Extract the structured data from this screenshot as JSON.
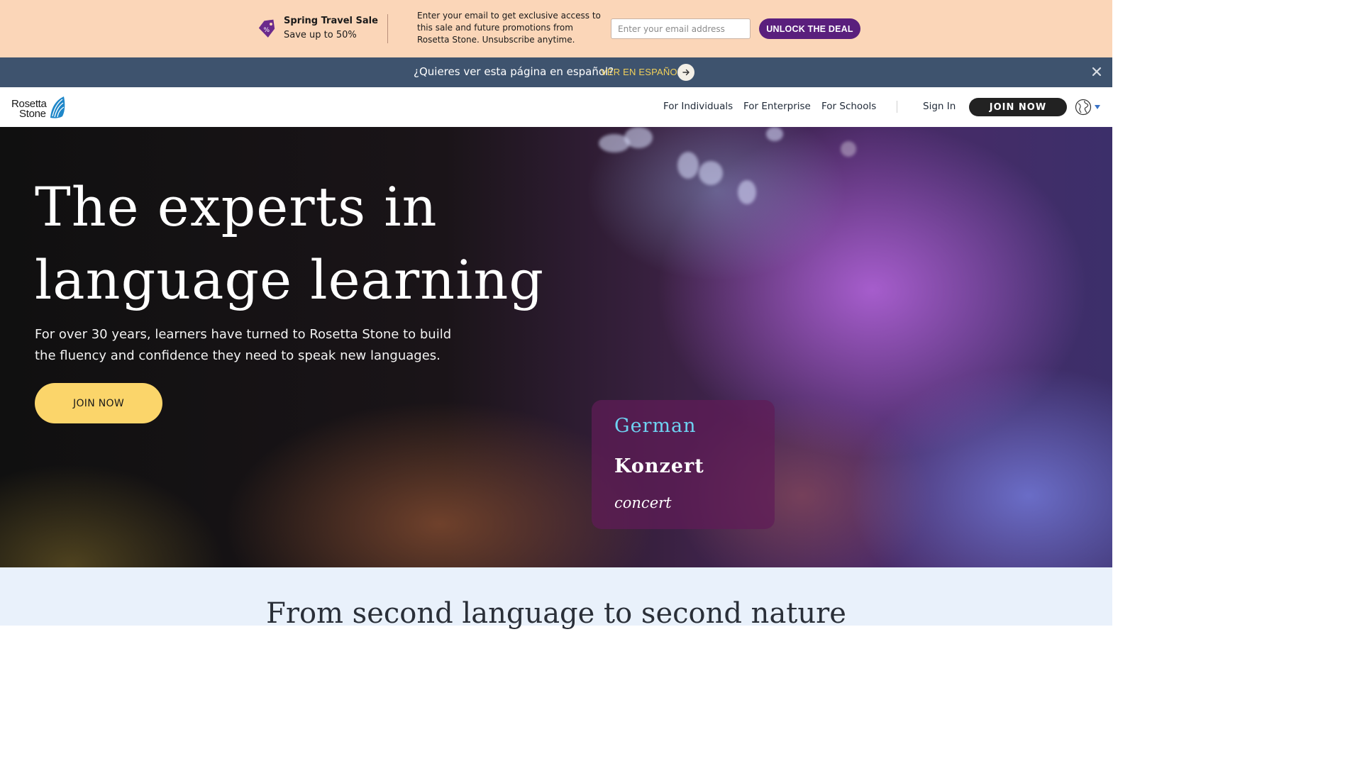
{
  "promo": {
    "title": "Spring Travel Sale",
    "subtitle": "Save up to 50%",
    "description": "Enter your email to get exclusive access to this sale and future promotions from Rosetta Stone. Unsubscribe anytime.",
    "email_placeholder": "Enter your email address",
    "cta_label": "UNLOCK THE DEAL",
    "bg_color": "#fbd6b8",
    "cta_color": "#5a1f7d",
    "icon": "discount-tag-icon"
  },
  "language_bar": {
    "question": "¿Quieres ver esta página en español?",
    "link_label": "VER EN ESPAÑOL",
    "link_color": "#f2d15a",
    "bg_color": "#3e536e",
    "icons": [
      "arrow-right-icon",
      "close-icon"
    ]
  },
  "nav": {
    "logo_line1": "Rosetta",
    "logo_line2": "Stone",
    "items": [
      {
        "label": "For Individuals"
      },
      {
        "label": "For Enterprise"
      },
      {
        "label": "For Schools"
      }
    ],
    "sign_in_label": "Sign In",
    "join_label": "JOIN NOW",
    "icons": [
      "globe-icon",
      "chevron-down-icon"
    ]
  },
  "hero": {
    "title": "The experts in language learning",
    "subtitle": "For over 30 years, learners have turned to Rosetta Stone to build the fluency and confidence they need to speak new languages.",
    "cta_label": "JOIN NOW",
    "cta_color": "#fbd56a",
    "word_card": {
      "language": "German",
      "word": "Konzert",
      "translation": "concert",
      "language_color": "#6ed3f2"
    }
  },
  "section": {
    "title": "From second language to second nature",
    "bg_color": "#e9f1fb"
  }
}
